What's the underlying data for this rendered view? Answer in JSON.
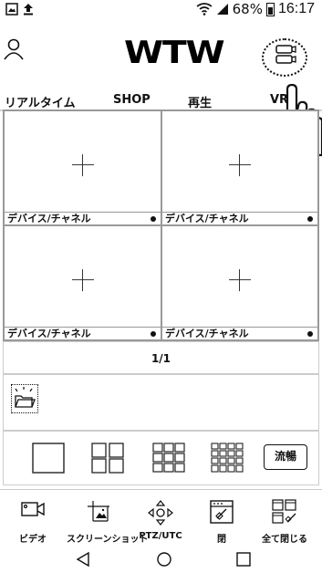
{
  "status": {
    "battery": "68%",
    "time": "16:17"
  },
  "header": {
    "logo": "WTW"
  },
  "nav": {
    "tabs": [
      "リアルタイム",
      "SHOP",
      "再生",
      "VR"
    ]
  },
  "grid": {
    "cells": [
      {
        "label": "デバイス/チャネル"
      },
      {
        "label": "デバイス/チャネル"
      },
      {
        "label": "デバイス/チャネル"
      },
      {
        "label": "デバイス/チャネル"
      }
    ],
    "page": "1/1"
  },
  "layout": {
    "fluent": "流暢"
  },
  "toolbar": {
    "video": "ビデオ",
    "screenshot": "スクリーンショット",
    "ptz": "PTZ/UTC",
    "close": "閉",
    "close_all": "全て閉じる"
  }
}
